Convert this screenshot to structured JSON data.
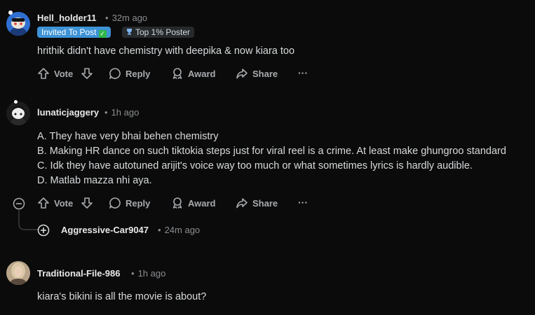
{
  "comments": [
    {
      "username": "Hell_holder11",
      "time": "32m ago",
      "flairs": {
        "invited": "Invited To Post",
        "invited_check": "✓",
        "top": "Top 1% Poster"
      },
      "body": [
        "hrithik didn't have chemistry with deepika & now kiara too"
      ]
    },
    {
      "username": "lunaticjaggery",
      "time": "1h ago",
      "body": [
        "A. They have very bhai behen chemistry",
        "B. Making HR dance on such tiktokia steps just for viral reel is a crime. At least make ghungroo standard",
        "C. Idk they have autotuned arijit's voice way too much or what sometimes lyrics is hardly audible.",
        "D. Matlab mazza nhi aya."
      ]
    },
    {
      "username": "Aggressive-Car9047",
      "time": "24m ago"
    },
    {
      "username": "Traditional-File-986",
      "time": "1h ago",
      "body": [
        "kiara's bikini is all the movie is about?"
      ]
    }
  ],
  "actions": {
    "vote": "Vote",
    "reply": "Reply",
    "award": "Award",
    "share": "Share",
    "more": "···"
  },
  "colors": {
    "background": "#0b0b0b",
    "flair_invite": "#3d93d6",
    "flair_top": "#272a2d",
    "text": "#d7dadc",
    "muted": "#8a8d90"
  }
}
